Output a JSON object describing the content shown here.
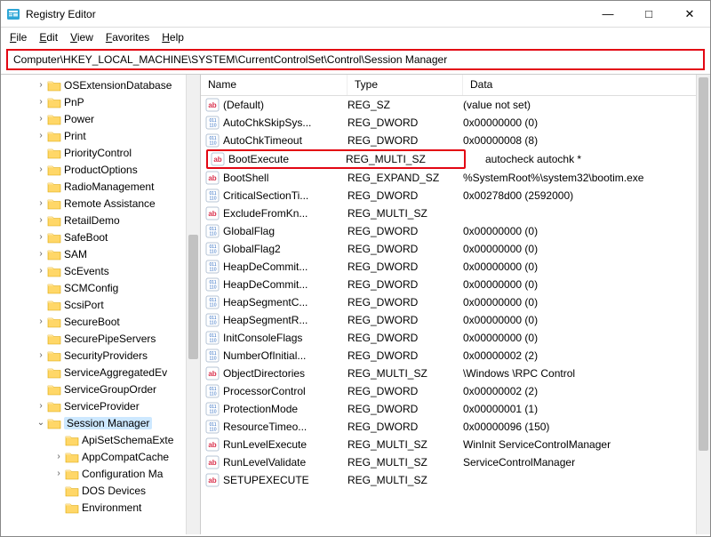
{
  "window": {
    "title": "Registry Editor"
  },
  "menu": {
    "file": "File",
    "edit": "Edit",
    "view": "View",
    "favorites": "Favorites",
    "help": "Help"
  },
  "address": "Computer\\HKEY_LOCAL_MACHINE\\SYSTEM\\CurrentControlSet\\Control\\Session Manager",
  "columns": {
    "name": "Name",
    "type": "Type",
    "data": "Data"
  },
  "tree": [
    {
      "depth": 1,
      "exp": ">",
      "label": "OSExtensionDatabase"
    },
    {
      "depth": 1,
      "exp": ">",
      "label": "PnP"
    },
    {
      "depth": 1,
      "exp": ">",
      "label": "Power"
    },
    {
      "depth": 1,
      "exp": ">",
      "label": "Print"
    },
    {
      "depth": 1,
      "exp": "",
      "label": "PriorityControl"
    },
    {
      "depth": 1,
      "exp": ">",
      "label": "ProductOptions"
    },
    {
      "depth": 1,
      "exp": "",
      "label": "RadioManagement"
    },
    {
      "depth": 1,
      "exp": ">",
      "label": "Remote Assistance"
    },
    {
      "depth": 1,
      "exp": ">",
      "label": "RetailDemo"
    },
    {
      "depth": 1,
      "exp": ">",
      "label": "SafeBoot"
    },
    {
      "depth": 1,
      "exp": ">",
      "label": "SAM"
    },
    {
      "depth": 1,
      "exp": ">",
      "label": "ScEvents"
    },
    {
      "depth": 1,
      "exp": "",
      "label": "SCMConfig"
    },
    {
      "depth": 1,
      "exp": "",
      "label": "ScsiPort"
    },
    {
      "depth": 1,
      "exp": ">",
      "label": "SecureBoot"
    },
    {
      "depth": 1,
      "exp": "",
      "label": "SecurePipeServers"
    },
    {
      "depth": 1,
      "exp": ">",
      "label": "SecurityProviders"
    },
    {
      "depth": 1,
      "exp": "",
      "label": "ServiceAggregatedEv"
    },
    {
      "depth": 1,
      "exp": "",
      "label": "ServiceGroupOrder"
    },
    {
      "depth": 1,
      "exp": ">",
      "label": "ServiceProvider"
    },
    {
      "depth": 1,
      "exp": "v",
      "label": "Session Manager",
      "selected": true
    },
    {
      "depth": 2,
      "exp": "",
      "label": "ApiSetSchemaExte"
    },
    {
      "depth": 2,
      "exp": ">",
      "label": "AppCompatCache"
    },
    {
      "depth": 2,
      "exp": ">",
      "label": "Configuration Ma"
    },
    {
      "depth": 2,
      "exp": "",
      "label": "DOS Devices"
    },
    {
      "depth": 2,
      "exp": "",
      "label": "Environment"
    }
  ],
  "values": [
    {
      "icon": "ab",
      "name": "(Default)",
      "type": "REG_SZ",
      "data": "(value not set)"
    },
    {
      "icon": "bin",
      "name": "AutoChkSkipSys...",
      "type": "REG_DWORD",
      "data": "0x00000000 (0)"
    },
    {
      "icon": "bin",
      "name": "AutoChkTimeout",
      "type": "REG_DWORD",
      "data": "0x00000008 (8)"
    },
    {
      "icon": "ab",
      "name": "BootExecute",
      "type": "REG_MULTI_SZ",
      "data": "autocheck autochk *",
      "highlighted": true,
      "data_outside": true
    },
    {
      "icon": "ab",
      "name": "BootShell",
      "type": "REG_EXPAND_SZ",
      "data": "%SystemRoot%\\system32\\bootim.exe"
    },
    {
      "icon": "bin",
      "name": "CriticalSectionTi...",
      "type": "REG_DWORD",
      "data": "0x00278d00 (2592000)"
    },
    {
      "icon": "ab",
      "name": "ExcludeFromKn...",
      "type": "REG_MULTI_SZ",
      "data": ""
    },
    {
      "icon": "bin",
      "name": "GlobalFlag",
      "type": "REG_DWORD",
      "data": "0x00000000 (0)"
    },
    {
      "icon": "bin",
      "name": "GlobalFlag2",
      "type": "REG_DWORD",
      "data": "0x00000000 (0)"
    },
    {
      "icon": "bin",
      "name": "HeapDeCommit...",
      "type": "REG_DWORD",
      "data": "0x00000000 (0)"
    },
    {
      "icon": "bin",
      "name": "HeapDeCommit...",
      "type": "REG_DWORD",
      "data": "0x00000000 (0)"
    },
    {
      "icon": "bin",
      "name": "HeapSegmentC...",
      "type": "REG_DWORD",
      "data": "0x00000000 (0)"
    },
    {
      "icon": "bin",
      "name": "HeapSegmentR...",
      "type": "REG_DWORD",
      "data": "0x00000000 (0)"
    },
    {
      "icon": "bin",
      "name": "InitConsoleFlags",
      "type": "REG_DWORD",
      "data": "0x00000000 (0)"
    },
    {
      "icon": "bin",
      "name": "NumberOfInitial...",
      "type": "REG_DWORD",
      "data": "0x00000002 (2)"
    },
    {
      "icon": "ab",
      "name": "ObjectDirectories",
      "type": "REG_MULTI_SZ",
      "data": "\\Windows \\RPC Control"
    },
    {
      "icon": "bin",
      "name": "ProcessorControl",
      "type": "REG_DWORD",
      "data": "0x00000002 (2)"
    },
    {
      "icon": "bin",
      "name": "ProtectionMode",
      "type": "REG_DWORD",
      "data": "0x00000001 (1)"
    },
    {
      "icon": "bin",
      "name": "ResourceTimeo...",
      "type": "REG_DWORD",
      "data": "0x00000096 (150)"
    },
    {
      "icon": "ab",
      "name": "RunLevelExecute",
      "type": "REG_MULTI_SZ",
      "data": "WinInit ServiceControlManager"
    },
    {
      "icon": "ab",
      "name": "RunLevelValidate",
      "type": "REG_MULTI_SZ",
      "data": "ServiceControlManager"
    },
    {
      "icon": "ab",
      "name": "SETUPEXECUTE",
      "type": "REG_MULTI_SZ",
      "data": ""
    }
  ]
}
